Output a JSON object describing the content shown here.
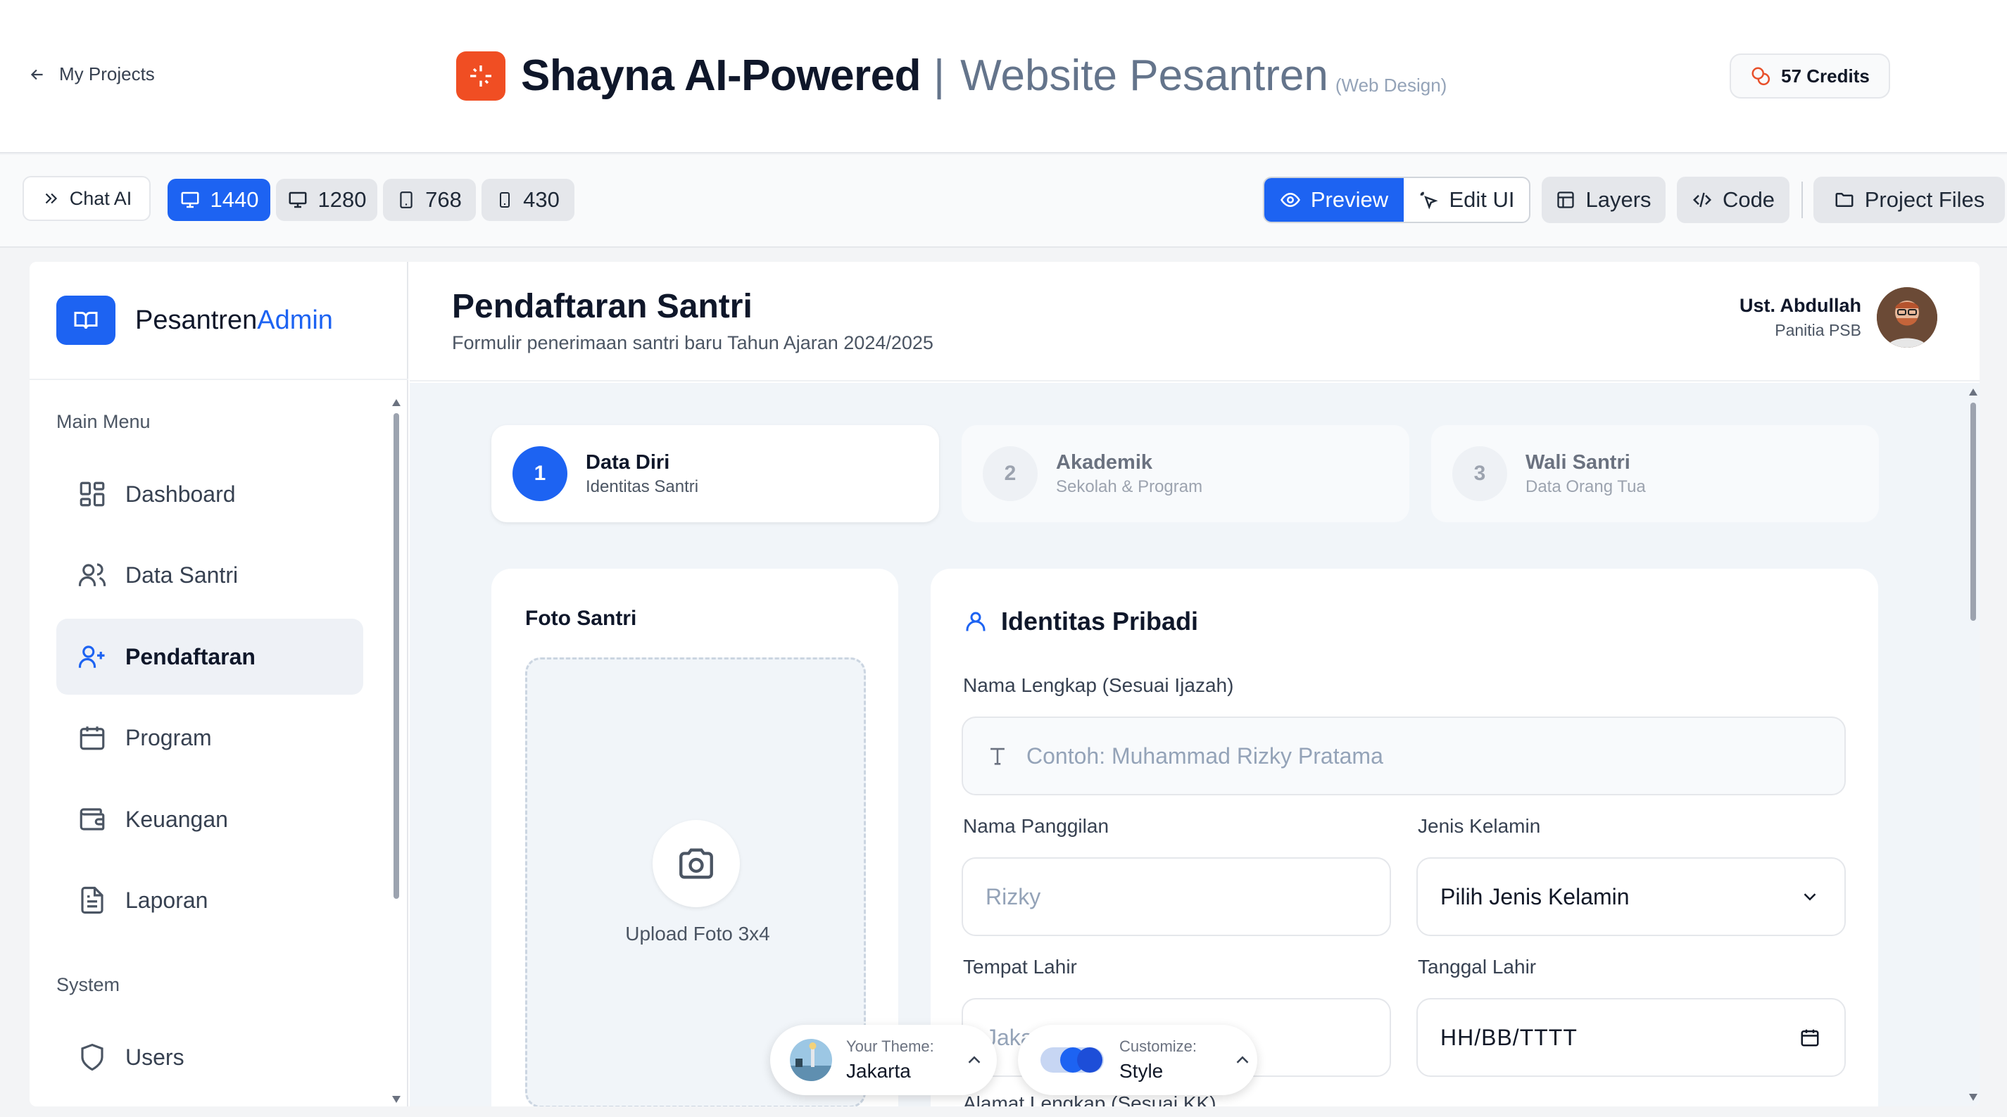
{
  "topbar": {
    "back_label": "My Projects",
    "title_main": "Shayna AI-Powered",
    "title_sep": "|",
    "title_sub": "Website Pesantren",
    "title_tag": "(Web Design)",
    "credits": "57 Credits"
  },
  "toolbar": {
    "chat_label": "Chat AI",
    "viewports": [
      "1440",
      "1280",
      "768",
      "430"
    ],
    "active_viewport": "1440",
    "preview_label": "Preview",
    "edit_label": "Edit UI",
    "layers_label": "Layers",
    "code_label": "Code",
    "files_label": "Project Files"
  },
  "sidebar": {
    "brand_a": "Pesantren",
    "brand_b": "Admin",
    "main_menu_label": "Main Menu",
    "items": [
      {
        "label": "Dashboard",
        "icon": "dashboard-icon"
      },
      {
        "label": "Data Santri",
        "icon": "users-icon"
      },
      {
        "label": "Pendaftaran",
        "icon": "user-plus-icon",
        "active": true
      },
      {
        "label": "Program",
        "icon": "calendar-icon"
      },
      {
        "label": "Keuangan",
        "icon": "wallet-icon"
      },
      {
        "label": "Laporan",
        "icon": "file-text-icon"
      }
    ],
    "system_label": "System",
    "system_items": [
      {
        "label": "Users",
        "icon": "shield-icon"
      }
    ]
  },
  "header": {
    "title": "Pendaftaran Santri",
    "subtitle": "Formulir penerimaan santri baru Tahun Ajaran 2024/2025",
    "user_name": "Ust. Abdullah",
    "user_role": "Panitia PSB"
  },
  "steps": [
    {
      "num": "1",
      "title": "Data Diri",
      "sub": "Identitas Santri",
      "active": true
    },
    {
      "num": "2",
      "title": "Akademik",
      "sub": "Sekolah & Program",
      "active": false
    },
    {
      "num": "3",
      "title": "Wali Santri",
      "sub": "Data Orang Tua",
      "active": false
    }
  ],
  "photo": {
    "title": "Foto Santri",
    "upload_label": "Upload Foto 3x4"
  },
  "form": {
    "section_title": "Identitas Pribadi",
    "nama_lengkap_label": "Nama Lengkap (Sesuai Ijazah)",
    "nama_lengkap_placeholder": "Contoh: Muhammad Rizky Pratama",
    "nama_panggilan_label": "Nama Panggilan",
    "nama_panggilan_placeholder": "Rizky",
    "jenis_kelamin_label": "Jenis Kelamin",
    "jenis_kelamin_value": "Pilih Jenis Kelamin",
    "tempat_lahir_label": "Tempat Lahir",
    "tempat_lahir_placeholder": "Jakarta",
    "tanggal_lahir_label": "Tanggal Lahir",
    "tanggal_lahir_value": "HH/BB/TTTT",
    "alamat_label": "Alamat Lengkap (Sesuai KK)"
  },
  "theme_pill": {
    "label": "Your Theme:",
    "value": "Jakarta"
  },
  "customize_pill": {
    "label": "Customize:",
    "value": "Style"
  },
  "colors": {
    "accent": "#1d63f2",
    "brand_logo": "#f04e23",
    "active_nav_bg": "#eef1f6"
  }
}
